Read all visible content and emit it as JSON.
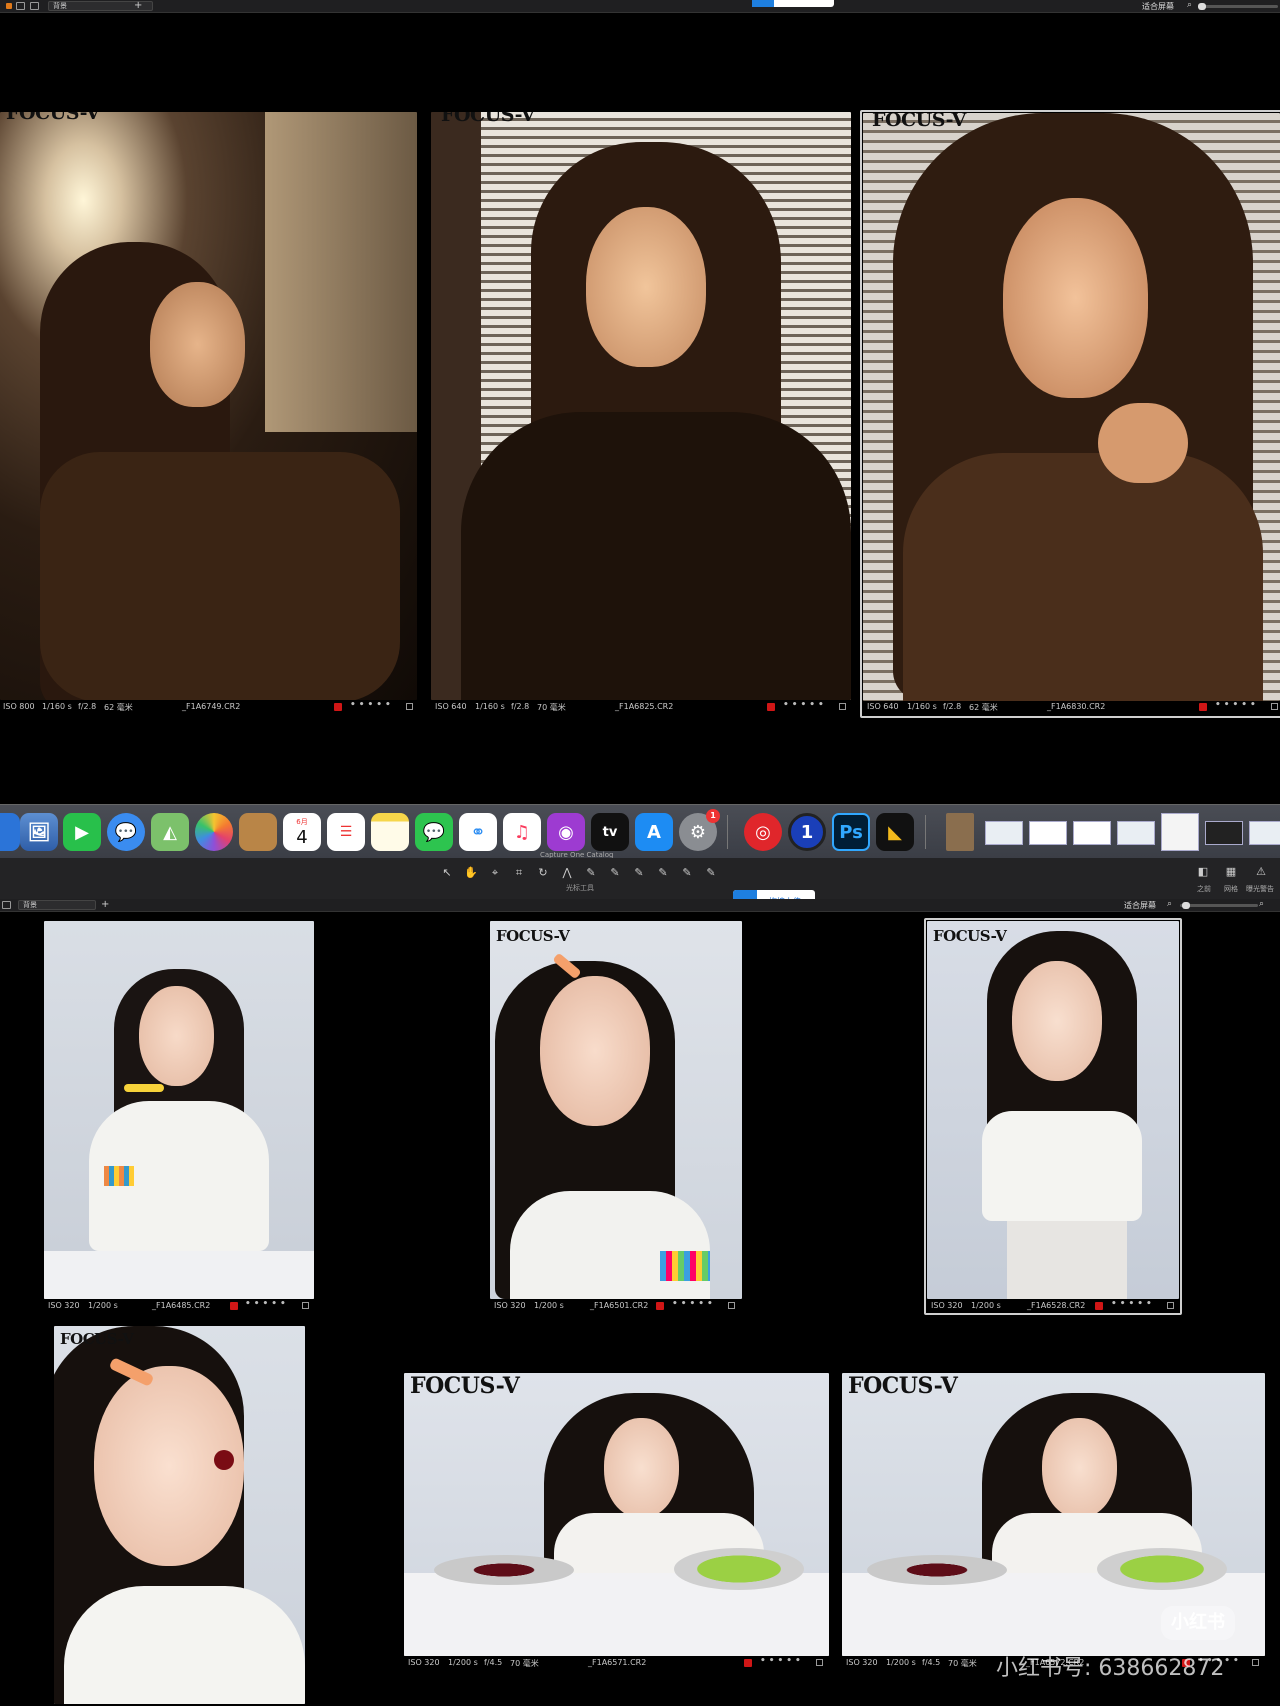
{
  "top_bar": {
    "dropdown": "背景",
    "fit_label": "适合屏幕"
  },
  "top_upload_label": "",
  "upper_grid": [
    {
      "logo": "FOCUS-V",
      "iso": "ISO 800",
      "shutter": "1/160 s",
      "aperture": "f/2.8",
      "focal": "62 毫米",
      "file": "_F1A6749.CR2"
    },
    {
      "logo": "FOCUS-V",
      "iso": "ISO 640",
      "shutter": "1/160 s",
      "aperture": "f/2.8",
      "focal": "70 毫米",
      "file": "_F1A6825.CR2"
    },
    {
      "logo": "FOCUS-V",
      "iso": "ISO 640",
      "shutter": "1/160 s",
      "aperture": "f/2.8",
      "focal": "62 毫米",
      "file": "_F1A6830.CR2"
    }
  ],
  "dock": {
    "icons": [
      "finder-icon",
      "preview-icon",
      "facetime-icon",
      "messages-icon",
      "maps-icon",
      "photos-icon",
      "contacts-icon",
      "calendar-icon",
      "reminders-icon",
      "notes-icon",
      "wechat-icon",
      "baidu-netdisk-icon",
      "music-icon",
      "podcasts-icon",
      "appletv-icon",
      "appstore-icon",
      "system-settings-icon",
      "netease-music-icon",
      "1password-icon",
      "photoshop-icon",
      "final-cut-icon"
    ],
    "calendar_month": "6月",
    "calendar_day": "4",
    "settings_badge": "1",
    "ps_label": "Ps",
    "tv_label": "tv",
    "onepassword_label": "1",
    "catalog_label": "Capture One Catalog"
  },
  "toolbar": {
    "cursor_tools_label": "光标工具",
    "before_label": "之前",
    "grid_label": "网格",
    "exposure_warning_label": "曝光警告",
    "dropdown": "背景",
    "fit_label": "适合屏幕",
    "upload_label": "拖拽上传"
  },
  "lower_grid": [
    {
      "logo": "",
      "iso": "ISO 320",
      "shutter": "1/200 s",
      "file": "_F1A6485.CR2"
    },
    {
      "logo": "FOCUS-V",
      "iso": "ISO 320",
      "shutter": "1/200 s",
      "file": "_F1A6501.CR2"
    },
    {
      "logo": "FOCUS-V",
      "iso": "ISO 320",
      "shutter": "1/200 s",
      "file": "_F1A6528.CR2"
    },
    {
      "logo": "FOCUS-V",
      "iso": "",
      "shutter": "",
      "file": ""
    },
    {
      "logo": "FOCUS-V",
      "iso": "ISO 320",
      "shutter": "1/200 s",
      "aperture": "f/4.5",
      "focal": "70 毫米",
      "file": "_F1A6571.CR2"
    },
    {
      "logo": "FOCUS-V",
      "iso": "ISO 320",
      "shutter": "1/200 s",
      "aperture": "f/4.5",
      "focal": "70 毫米",
      "file": "_F1A6572.CR2"
    }
  ],
  "watermark": {
    "id_text": "小红书号: 638662872",
    "brand": "小红书"
  },
  "colors": {
    "rating_red": "#d01616",
    "accent_blue": "#1e7fe0"
  }
}
